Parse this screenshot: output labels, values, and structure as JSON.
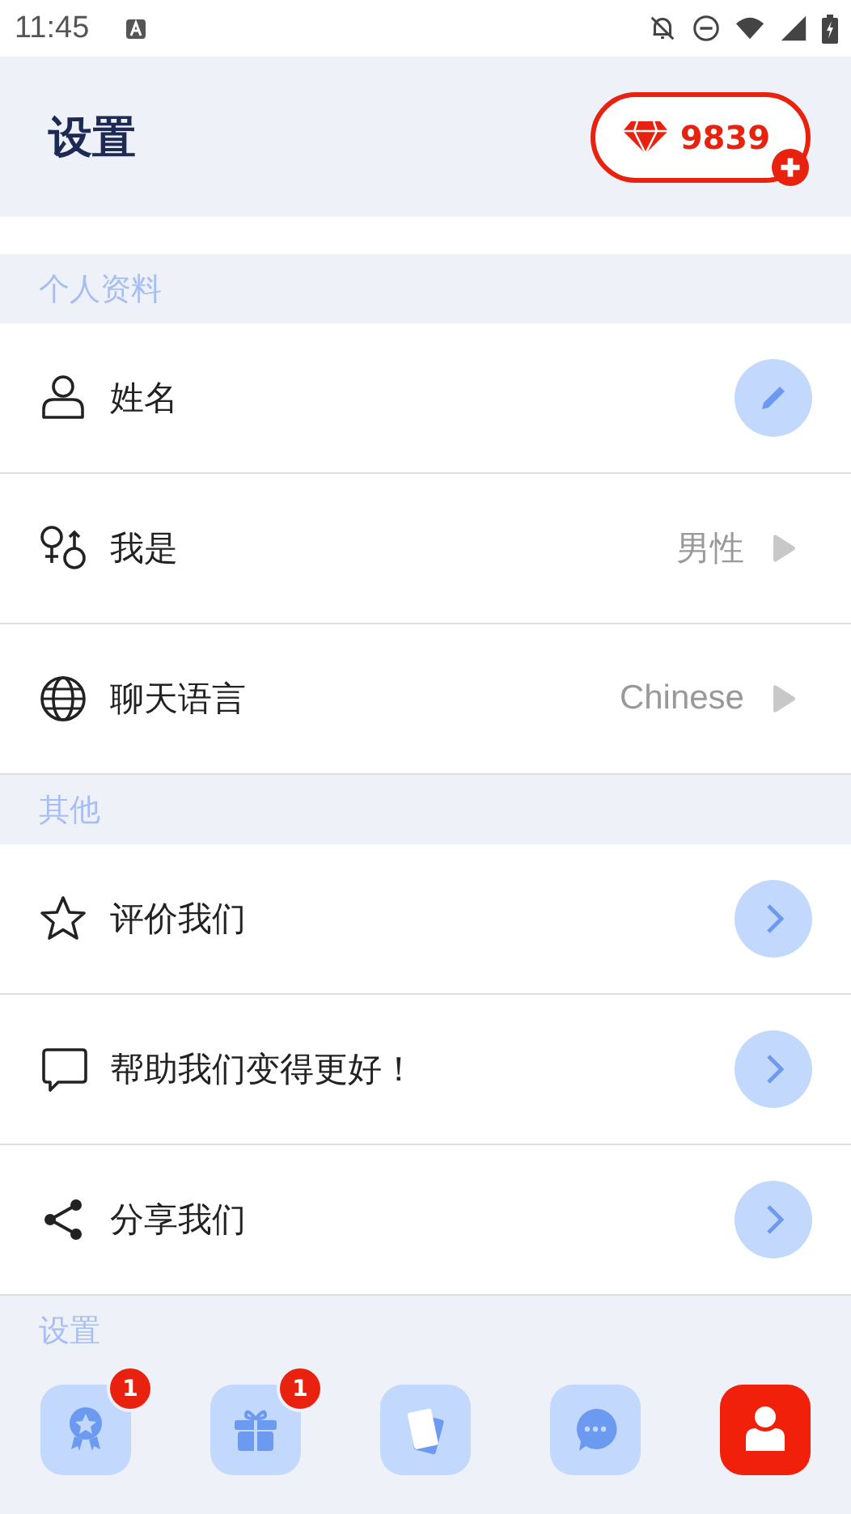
{
  "status_bar": {
    "time": "11:45"
  },
  "header": {
    "title": "设置",
    "gems": "9839"
  },
  "sections": [
    {
      "title": "个人资料",
      "rows": [
        {
          "label": "姓名",
          "kind": "edit"
        },
        {
          "label": "我是",
          "kind": "value",
          "value": "男性"
        },
        {
          "label": "聊天语言",
          "kind": "value",
          "value": "Chinese"
        }
      ]
    },
    {
      "title": "其他",
      "rows": [
        {
          "label": "评价我们",
          "kind": "link"
        },
        {
          "label": "帮助我们变得更好！",
          "kind": "link"
        },
        {
          "label": "分享我们",
          "kind": "link"
        }
      ]
    },
    {
      "title": "设置"
    }
  ],
  "tab_bar": [
    {
      "selected": false,
      "badge": "1"
    },
    {
      "selected": false,
      "badge": "1"
    },
    {
      "selected": false
    },
    {
      "selected": false
    },
    {
      "selected": true
    }
  ]
}
